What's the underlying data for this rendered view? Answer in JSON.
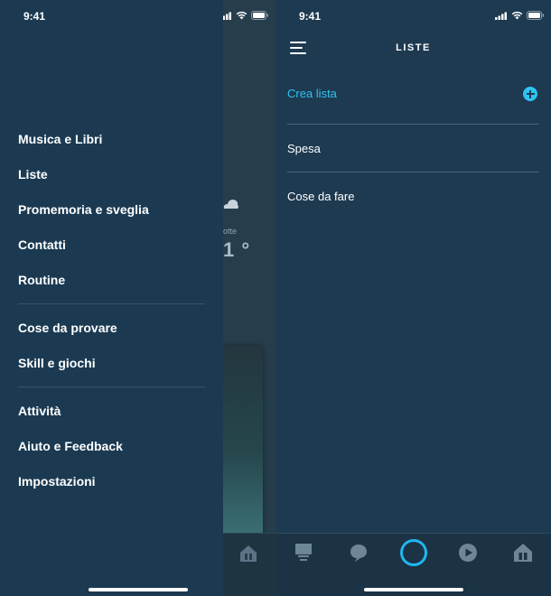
{
  "left": {
    "status_time": "9:41",
    "background": {
      "weather_label": "otte",
      "weather_temp": "1 °"
    },
    "menu": {
      "group1": [
        "Musica e Libri",
        "Liste",
        "Promemoria e sveglia",
        "Contatti",
        "Routine"
      ],
      "group2": [
        "Cose da provare",
        "Skill e giochi"
      ],
      "group3": [
        "Attività",
        "Aiuto e Feedback",
        "Impostazioni"
      ]
    }
  },
  "right": {
    "status_time": "9:41",
    "header_title": "LISTE",
    "create_label": "Crea lista",
    "lists": [
      "Spesa",
      "Cose da fare"
    ],
    "tabs": [
      "home-icon",
      "chat-icon",
      "alexa-icon",
      "play-icon",
      "devices-icon"
    ]
  },
  "colors": {
    "drawer_bg": "#1b3a52",
    "screen_bg": "#1d3a51",
    "accent": "#2ec4f3",
    "alexa_ring": "#1fb7ef",
    "divider": "#35536a"
  }
}
